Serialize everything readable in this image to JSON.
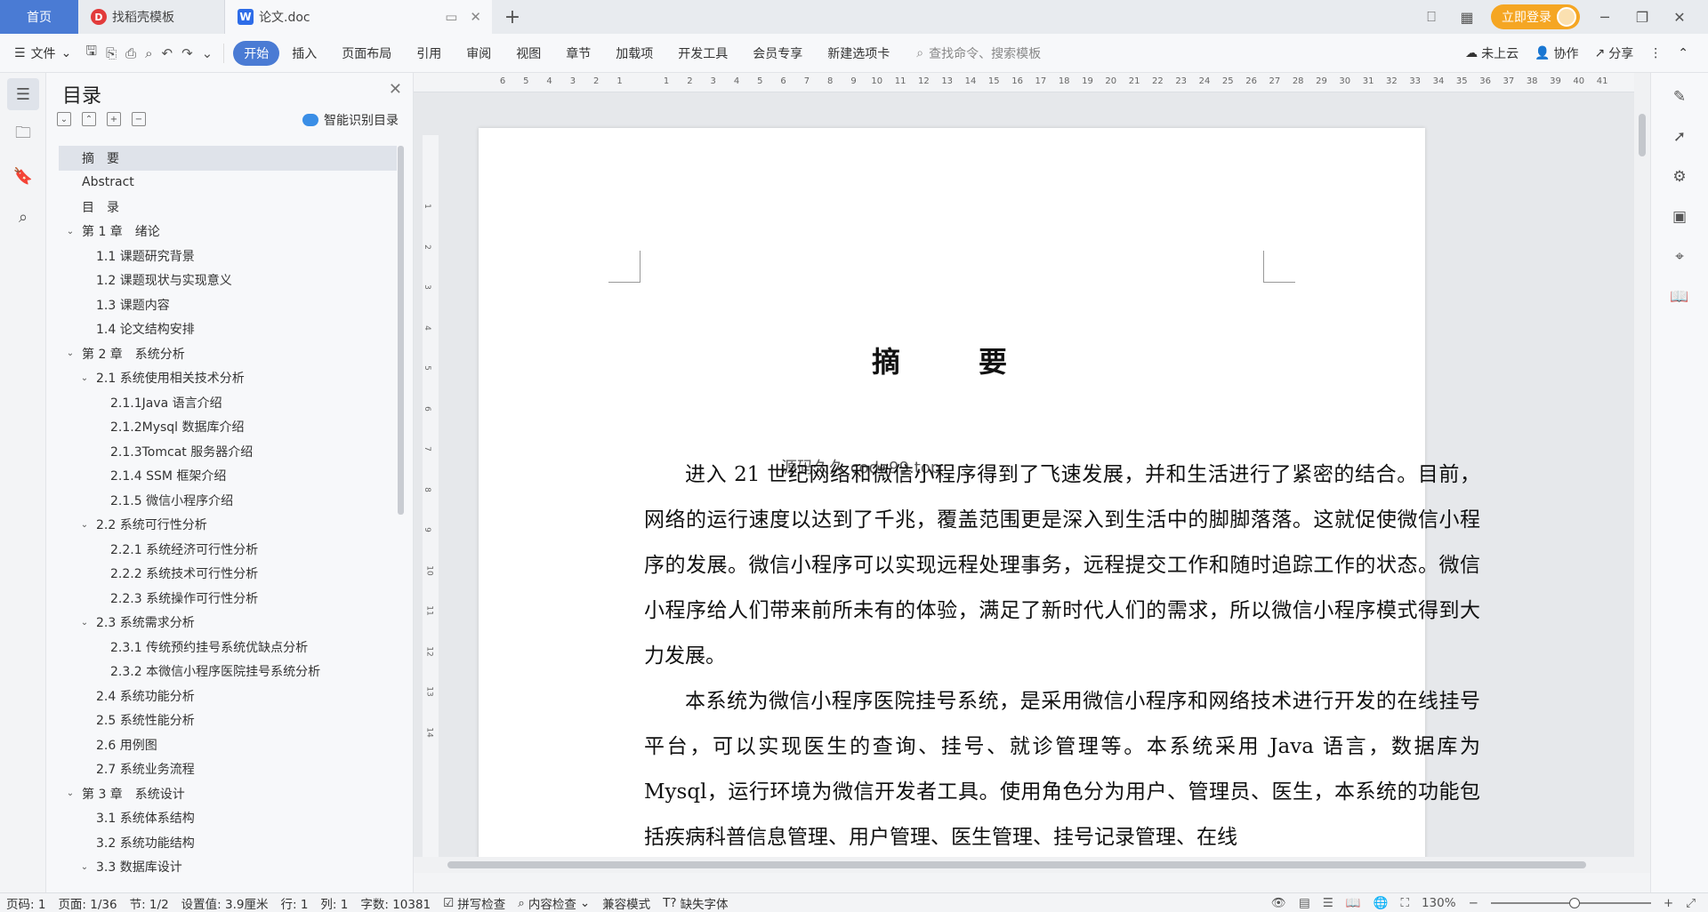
{
  "tabs": {
    "home": "首页",
    "template": "找稻壳模板",
    "doc": "论文.doc"
  },
  "topbar": {
    "login": "立即登录"
  },
  "ribbon": {
    "file": "文件",
    "menus": [
      "开始",
      "插入",
      "页面布局",
      "引用",
      "审阅",
      "视图",
      "章节",
      "加载项",
      "开发工具",
      "会员专享",
      "新建选项卡"
    ],
    "search_placeholder": "查找命令、搜索模板",
    "cloud": "未上云",
    "collab": "协作",
    "share": "分享"
  },
  "toc": {
    "title": "目录",
    "smart_label": "智能识别目录",
    "items": [
      {
        "text": "摘　要",
        "level": 0,
        "expand": false,
        "selected": true
      },
      {
        "text": "Abstract",
        "level": 0,
        "expand": false
      },
      {
        "text": "目　录",
        "level": 0,
        "expand": false
      },
      {
        "text": "第 1 章　绪论",
        "level": 0,
        "expand": true
      },
      {
        "text": "1.1 课题研究背景",
        "level": 1,
        "expand": false
      },
      {
        "text": "1.2 课题现状与实现意义",
        "level": 1,
        "expand": false
      },
      {
        "text": "1.3 课题内容",
        "level": 1,
        "expand": false
      },
      {
        "text": "1.4 论文结构安排",
        "level": 1,
        "expand": false
      },
      {
        "text": "第 2 章　系统分析",
        "level": 0,
        "expand": true
      },
      {
        "text": "2.1 系统使用相关技术分析",
        "level": 1,
        "expand": true
      },
      {
        "text": "2.1.1Java 语言介绍",
        "level": 2,
        "expand": false
      },
      {
        "text": "2.1.2Mysql 数据库介绍",
        "level": 2,
        "expand": false
      },
      {
        "text": "2.1.3Tomcat 服务器介绍",
        "level": 2,
        "expand": false
      },
      {
        "text": "2.1.4 SSM 框架介绍",
        "level": 2,
        "expand": false
      },
      {
        "text": "2.1.5 微信小程序介绍",
        "level": 2,
        "expand": false
      },
      {
        "text": "2.2 系统可行性分析",
        "level": 1,
        "expand": true
      },
      {
        "text": "2.2.1 系统经济可行性分析",
        "level": 2,
        "expand": false
      },
      {
        "text": "2.2.2 系统技术可行性分析",
        "level": 2,
        "expand": false
      },
      {
        "text": "2.2.3 系统操作可行性分析",
        "level": 2,
        "expand": false
      },
      {
        "text": "2.3 系统需求分析",
        "level": 1,
        "expand": true
      },
      {
        "text": "2.3.1 传统预约挂号系统优缺点分析",
        "level": 2,
        "expand": false
      },
      {
        "text": "2.3.2 本微信小程序医院挂号系统分析",
        "level": 2,
        "expand": false
      },
      {
        "text": "2.4 系统功能分析",
        "level": 1,
        "expand": false
      },
      {
        "text": "2.5 系统性能分析",
        "level": 1,
        "expand": false
      },
      {
        "text": "2.6 用例图",
        "level": 1,
        "expand": false
      },
      {
        "text": "2.7 系统业务流程",
        "level": 1,
        "expand": false
      },
      {
        "text": "第 3 章　系统设计",
        "level": 0,
        "expand": true
      },
      {
        "text": "3.1 系统体系结构",
        "level": 1,
        "expand": false
      },
      {
        "text": "3.2 系统功能结构",
        "level": 1,
        "expand": false
      },
      {
        "text": "3.3 数据库设计",
        "level": 1,
        "expand": true
      }
    ]
  },
  "ruler": {
    "ticks": [
      "6",
      "5",
      "4",
      "3",
      "2",
      "1",
      "",
      "1",
      "2",
      "3",
      "4",
      "5",
      "6",
      "7",
      "8",
      "9",
      "10",
      "11",
      "12",
      "13",
      "14",
      "15",
      "16",
      "17",
      "18",
      "19",
      "20",
      "21",
      "22",
      "23",
      "24",
      "25",
      "26",
      "27",
      "28",
      "29",
      "30",
      "31",
      "32",
      "33",
      "34",
      "35",
      "36",
      "37",
      "38",
      "39",
      "40",
      "41"
    ],
    "vticks": [
      "1",
      "2",
      "3",
      "4",
      "5",
      "6",
      "7",
      "8",
      "9",
      "10",
      "11",
      "12",
      "13",
      "14"
    ]
  },
  "document": {
    "title": "摘　要",
    "watermark": "源码久久 code99.top",
    "paragraphs": [
      "进入 21 世纪网络和微信小程序得到了飞速发展，并和生活进行了紧密的结合。目前，网络的运行速度以达到了千兆，覆盖范围更是深入到生活中的脚脚落落。这就促使微信小程序的发展。微信小程序可以实现远程处理事务，远程提交工作和随时追踪工作的状态。微信小程序给人们带来前所未有的体验，满足了新时代人们的需求，所以微信小程序模式得到大力发展。",
      "本系统为微信小程序医院挂号系统，是采用微信小程序和网络技术进行开发的在线挂号平台，可以实现医生的查询、挂号、就诊管理等。本系统采用 Java 语言，数据库为 Mysql，运行环境为微信开发者工具。使用角色分为用户、管理员、医生，本系统的功能包括疾病科普信息管理、用户管理、医生管理、挂号记录管理、在线"
    ]
  },
  "status": {
    "page_code": "页码: 1",
    "page": "页面: 1/36",
    "section": "节: 1/2",
    "setting": "设置值: 3.9厘米",
    "row": "行: 1",
    "col": "列: 1",
    "words": "字数: 10381",
    "spell": "拼写检查",
    "content_check": "内容检查",
    "compat": "兼容模式",
    "missing_font": "缺失字体",
    "zoom": "130%"
  }
}
